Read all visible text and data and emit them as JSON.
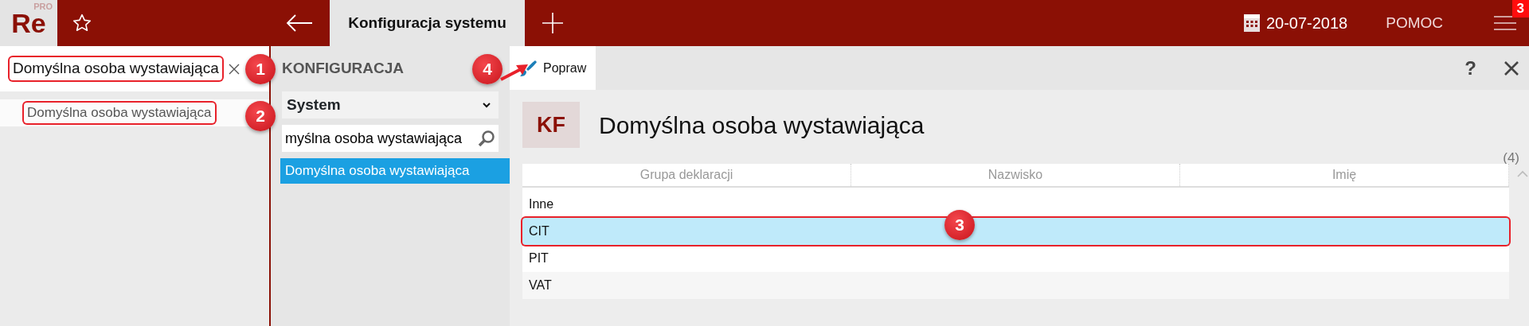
{
  "app": {
    "logo": "Re",
    "logo_sup": "PRO"
  },
  "tabs": [
    {
      "label": "Konfiguracja systemu",
      "selected": true
    }
  ],
  "date": "20-07-2018",
  "help_link": "POMOC",
  "menu_badge": "3",
  "left_panel": {
    "search": {
      "value": "Domyślna osoba wystawiająca",
      "highlighted": true
    },
    "results": [
      {
        "label": "Domyślna osoba wystawiająca",
        "selected": true,
        "highlighted": true
      }
    ]
  },
  "middle_panel": {
    "title": "KONFIGURACJA",
    "select": {
      "value": "System"
    },
    "search": {
      "value": "myślna osoba wystawiająca"
    },
    "items": [
      {
        "label": "Domyślna osoba wystawiająca",
        "selected": true
      }
    ]
  },
  "toolbar": {
    "buttons": [
      {
        "label": "Popraw"
      }
    ],
    "help": "?"
  },
  "form": {
    "badge": "KF",
    "title": "Domyślna osoba wystawiająca",
    "count": "(4)",
    "table": {
      "columns": [
        "Grupa deklaracji",
        "Nazwisko",
        "Imię"
      ],
      "rows": [
        {
          "cells": [
            "Inne"
          ],
          "selected": false,
          "highlighted": false
        },
        {
          "cells": [
            "CIT"
          ],
          "selected": true,
          "highlighted": true
        },
        {
          "cells": [
            "PIT"
          ],
          "selected": false,
          "highlighted": false
        },
        {
          "cells": [
            "VAT"
          ],
          "selected": false,
          "highlighted": false
        }
      ]
    }
  },
  "callouts": [
    {
      "number": "1"
    },
    {
      "number": "2"
    },
    {
      "number": "3"
    },
    {
      "number": "4"
    }
  ]
}
